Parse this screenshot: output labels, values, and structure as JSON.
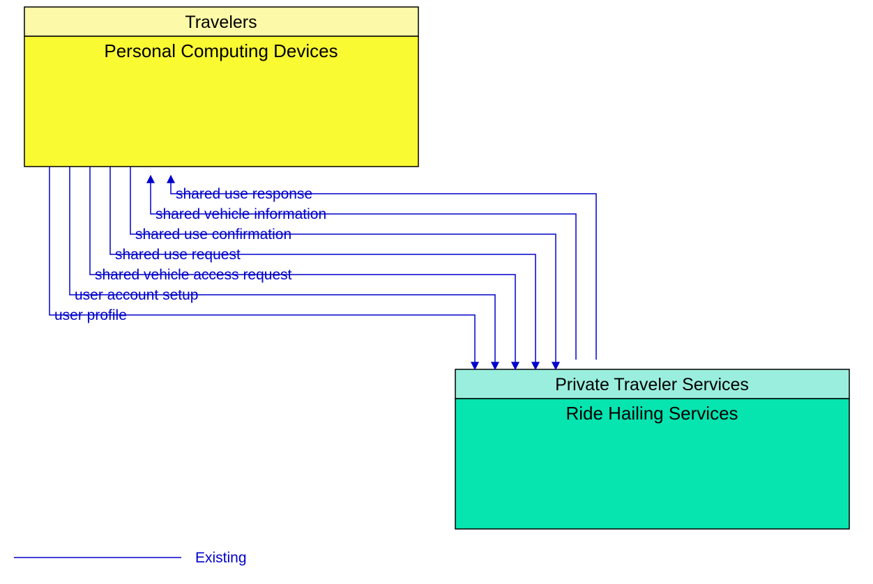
{
  "boxes": {
    "top": {
      "header": "Travelers",
      "body": "Personal Computing Devices"
    },
    "bottom": {
      "header": "Private Traveler Services",
      "body": "Ride Hailing Services"
    }
  },
  "flows": [
    {
      "label": "shared use response"
    },
    {
      "label": "shared vehicle information"
    },
    {
      "label": "shared use confirmation"
    },
    {
      "label": "shared use request"
    },
    {
      "label": "shared vehicle access request"
    },
    {
      "label": "user account setup"
    },
    {
      "label": "user profile"
    }
  ],
  "legend": {
    "existing": "Existing"
  }
}
